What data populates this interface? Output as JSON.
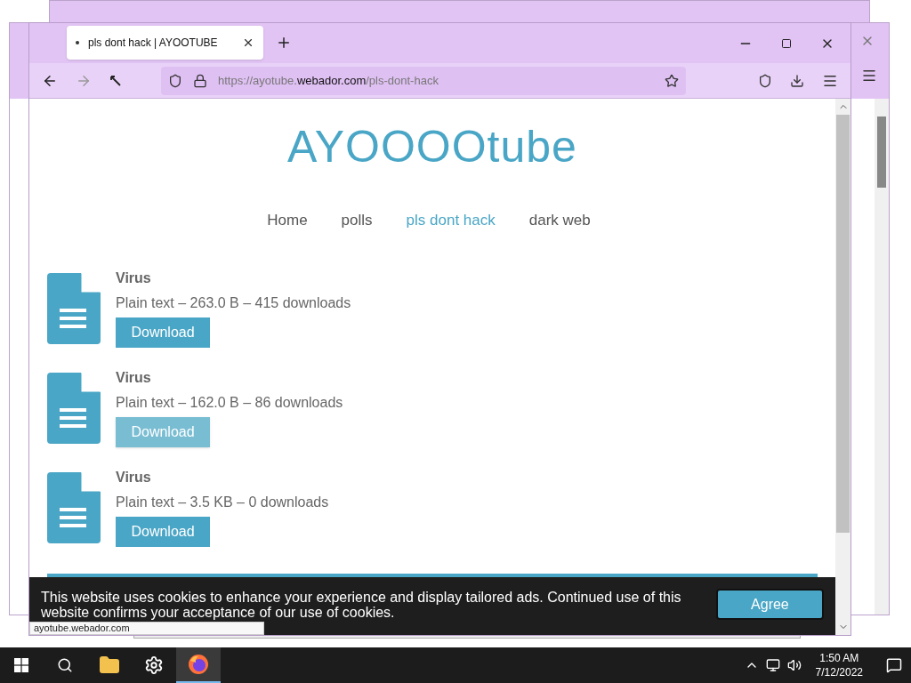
{
  "browser": {
    "tab": {
      "title": "pls dont hack | AYOOTUBE"
    },
    "url": {
      "prefix": "https://ayotube.",
      "domain": "webador.com",
      "path": "/pls-dont-hack"
    },
    "status_link": "ayotube.webador.com"
  },
  "site": {
    "logo": "AYOOOOtube",
    "nav": [
      {
        "label": "Home",
        "selected": false
      },
      {
        "label": "polls",
        "selected": false
      },
      {
        "label": "pls dont hack",
        "selected": true
      },
      {
        "label": "dark web",
        "selected": false
      }
    ]
  },
  "files": [
    {
      "title": "Virus",
      "meta": "Plain text – 263.0 B – 415 downloads",
      "button": "Download",
      "hovered": false
    },
    {
      "title": "Virus",
      "meta": "Plain text – 162.0 B – 86 downloads",
      "button": "Download",
      "hovered": true
    },
    {
      "title": "Virus",
      "meta": "Plain text – 3.5 KB – 0 downloads",
      "button": "Download",
      "hovered": false
    }
  ],
  "cookie_bar": {
    "text": "This website uses cookies to enhance your experience and display tailored ads. Continued use of this website confirms your acceptance of our use of cookies.",
    "button": "Agree"
  },
  "taskbar": {
    "apps": [
      {
        "kind": "search",
        "active": false
      },
      {
        "kind": "folder",
        "active": false
      },
      {
        "kind": "settings",
        "active": false
      },
      {
        "kind": "firefox",
        "active": true
      }
    ],
    "time": "1:50 AM",
    "date": "7/12/2022"
  }
}
